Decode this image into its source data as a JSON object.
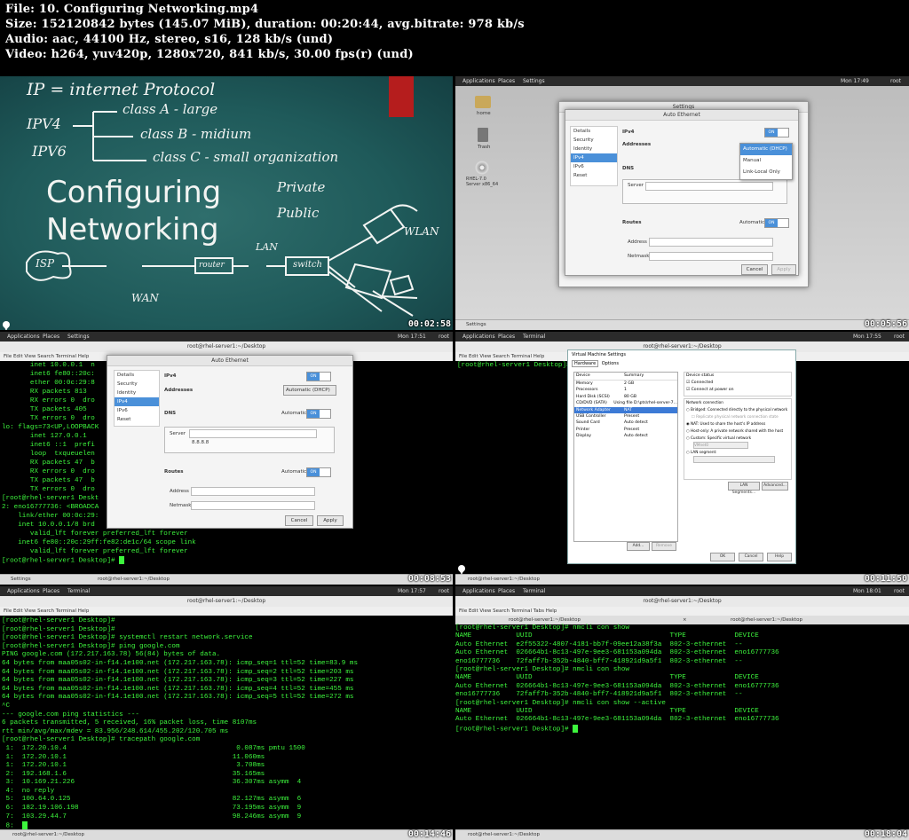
{
  "header": {
    "file": "File: 10. Configuring Networking.mp4",
    "size": "Size: 152120842 bytes (145.07 MiB), duration: 00:20:44, avg.bitrate: 978 kb/s",
    "audio": "Audio: aac, 44100 Hz, stereo, s16, 128 kb/s (und)",
    "video": "Video: h264, yuv420p, 1280x720, 841 kb/s, 30.00 fps(r) (und)"
  },
  "timestamps": [
    "00:02:58",
    "00:05:56",
    "00:08:53",
    "00:11:50",
    "00:14:46",
    "00:18:04"
  ],
  "board": {
    "title": "Configuring Networking",
    "line1": "IP = internet Protocol",
    "ipv4": "IPV4",
    "ipv6": "IPV6",
    "classA": "class A - large",
    "classB": "class B - midium",
    "classC": "class C - small organization",
    "private": "Private",
    "public": "Public",
    "isp": "ISP",
    "wan": "WAN",
    "lan": "LAN",
    "wlan": "WLAN",
    "switch": "switch",
    "router": "router"
  },
  "gnome": {
    "applications": "Applications",
    "places": "Places",
    "settings": "Settings",
    "terminal": "Terminal",
    "time2": "Mon 17:49",
    "time3": "Mon 17:51",
    "time4": "Mon 17:55",
    "time5": "Mon 17:57",
    "time6": "Mon 18:01",
    "user": "root",
    "home": "home",
    "trash": "Trash",
    "rhel": "RHEL-7.0 Server x86_64",
    "task_terminal": "root@rhel-server1:~/Desktop"
  },
  "network_dialog": {
    "window_title": "Settings",
    "title": "Auto Ethernet",
    "sidebar": [
      "Details",
      "Security",
      "Identity",
      "IPv4",
      "IPv6",
      "Reset"
    ],
    "ipv4": "IPv4",
    "addresses": "Addresses",
    "dns": "DNS",
    "automatic": "Automatic",
    "server": "Server",
    "server_value": "8.8.8.8",
    "routes": "Routes",
    "address": "Address",
    "netmask": "Netmask",
    "address_mode": "Automatic (DHCP)",
    "menu": [
      "Automatic (DHCP)",
      "Manual",
      "Link-Local Only"
    ],
    "cancel": "Cancel",
    "apply": "Apply",
    "on": "ON"
  },
  "term3": {
    "title": "root@rhel-server1:~/Desktop",
    "menu": "File  Edit  View  Search  Terminal  Help",
    "lines": [
      "       inet 10.0.0.1  n",
      "       inet6 fe80::20c:",
      "       ether 00:0c:29:8",
      "       RX packets 813",
      "       RX errors 0  dro",
      "       TX packets 405",
      "       TX errors 0  dro",
      "",
      "lo: flags=73<UP,LOOPBACK",
      "       inet 127.0.0.1",
      "       inet6 ::1  prefi",
      "       loop  txqueuelen",
      "       RX packets 47  b",
      "       RX errors 0  dro",
      "       TX packets 47  b",
      "       TX errors 0  dro",
      "",
      "[root@rhel-server1 Deskt",
      "2: eno16777736: <BROADCA                                     UP qlen 1000",
      "    link/ether 00:0c:29:",
      "    inet 10.0.0.1/8 brd",
      "       valid_lft forever preferred_lft forever",
      "    inet6 fe80::20c:29ff:fe82:de1c/64 scope link",
      "       valid_lft forever preferred_lft forever",
      "[root@rhel-server1 Desktop]# "
    ]
  },
  "vmsettings": {
    "title": "Virtual Machine Settings",
    "tabs": [
      "Hardware",
      "Options"
    ],
    "col_device": "Device",
    "col_summary": "Summary",
    "devices": [
      [
        "Memory",
        "2 GB"
      ],
      [
        "Processors",
        "1"
      ],
      [
        "Hard Disk (SCSI)",
        "80 GB"
      ],
      [
        "CD/DVD (SATA)",
        "Using file D:\\pts\\rhel-server-7..."
      ],
      [
        "Network Adapter",
        "NAT"
      ],
      [
        "USB Controller",
        "Present"
      ],
      [
        "Sound Card",
        "Auto detect"
      ],
      [
        "Printer",
        "Present"
      ],
      [
        "Display",
        "Auto detect"
      ]
    ],
    "device_status": "Device status",
    "connected": "Connected",
    "connect_power": "Connect at power on",
    "net_conn": "Network connection",
    "bridged": "Bridged: Connected directly to the physical network",
    "replicate": "Replicate physical network connection state",
    "nat": "NAT: Used to share the host's IP address",
    "hostonly": "Host-only: A private network shared with the host",
    "custom": "Custom: Specific virtual network",
    "vmnet": "VMnet0",
    "lan": "LAN segment:",
    "lan_btn": "LAN Segments...",
    "advanced": "Advanced...",
    "add": "Add...",
    "remove": "Remove",
    "ok": "OK",
    "cancel": "Cancel",
    "help": "Help",
    "term_title": "root@rhel-server1:~/Desktop",
    "term_prompt": "[root@rhel-server1 Desktop]#"
  },
  "term5": {
    "title": "root@rhel-server1:~/Desktop",
    "menu": "File  Edit  View  Search  Terminal  Help",
    "lines": [
      "[root@rhel-server1 Desktop]#",
      "[root@rhel-server1 Desktop]#",
      "[root@rhel-server1 Desktop]# systemctl restart network.service",
      "[root@rhel-server1 Desktop]# ping google.com",
      "PING google.com (172.217.163.78) 56(84) bytes of data.",
      "64 bytes from maa05s02-in-f14.1e100.net (172.217.163.78): icmp_seq=1 ttl=52 time=83.9 ms",
      "64 bytes from maa05s02-in-f14.1e100.net (172.217.163.78): icmp_seq=2 ttl=52 time=203 ms",
      "64 bytes from maa05s02-in-f14.1e100.net (172.217.163.78): icmp_seq=3 ttl=52 time=227 ms",
      "64 bytes from maa05s02-in-f14.1e100.net (172.217.163.78): icmp_seq=4 ttl=52 time=455 ms",
      "64 bytes from maa05s02-in-f14.1e100.net (172.217.163.78): icmp_seq=5 ttl=52 time=272 ms",
      "^C",
      "--- google.com ping statistics ---",
      "6 packets transmitted, 5 received, 16% packet loss, time 8107ms",
      "rtt min/avg/max/mdev = 83.956/248.614/455.202/120.705 ms",
      "[root@rhel-server1 Desktop]# tracepath google.com",
      " 1:  172.20.10.4                                          0.087ms pmtu 1500",
      " 1:  172.20.10.1                                         11.060ms",
      " 1:  172.20.10.1                                          3.708ms",
      " 2:  192.168.1.6                                         35.165ms",
      " 3:  10.169.21.226                                       36.307ms asymm  4",
      " 4:  no reply",
      " 5:  100.64.0.125                                        82.127ms asymm  6",
      " 6:  182.19.106.198                                      73.195ms asymm  9",
      " 7:  103.29.44.7                                         98.246ms asymm  9",
      " 8:  "
    ]
  },
  "term6": {
    "title": "root@rhel-server1:~/Desktop",
    "menu": "File  Edit  View  Search  Terminal  Tabs  Help",
    "tab1": "root@rhel-server1:~/Desktop",
    "tab2": "root@rhel-server1:~/Desktop",
    "lines": [
      "[root@rhel-server1 Desktop]# nmcli con show",
      "NAME           UUID                                  TYPE            DEVICE",
      "Auto Ethernet  e2f55322-4807-4181-bb7f-09ee12a38f3a  802-3-ethernet  --",
      "Auto Ethernet  026664b1-8c13-497e-9ee3-681153a094da  802-3-ethernet  eno16777736",
      "eno16777736    72faff7b-352b-4840-bff7-418921d9a5f1  802-3-ethernet  --",
      "[root@rhel-server1 Desktop]# nmcli con show",
      "NAME           UUID                                  TYPE            DEVICE",
      "Auto Ethernet  026664b1-8c13-497e-9ee3-681153a094da  802-3-ethernet  eno16777736",
      "eno16777736    72faff7b-352b-4840-bff7-418921d9a5f1  802-3-ethernet  --",
      "[root@rhel-server1 Desktop]# nmcli con show --active",
      "NAME           UUID                                  TYPE            DEVICE",
      "Auto Ethernet  026664b1-8c13-497e-9ee3-681153a094da  802-3-ethernet  eno16777736",
      "[root@rhel-server1 Desktop]# "
    ]
  }
}
